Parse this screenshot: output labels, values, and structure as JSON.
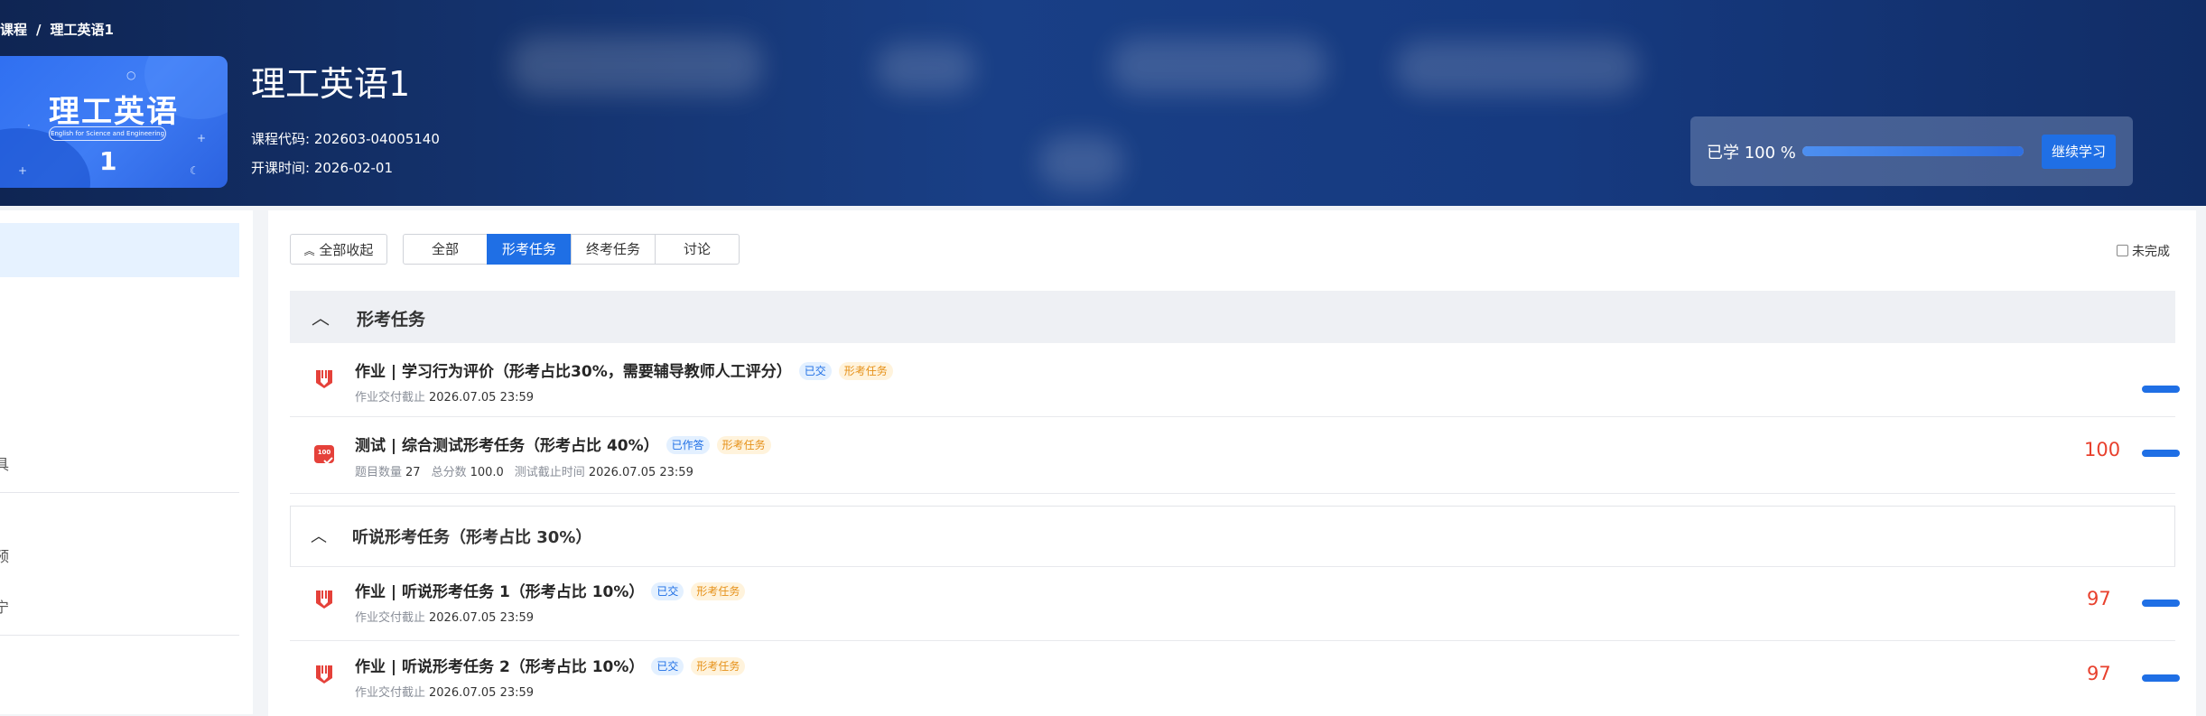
{
  "breadcrumb": {
    "parent": "我的课程",
    "separator": "/",
    "current": "理工英语1"
  },
  "course": {
    "cover_title": "理工英语",
    "cover_subtitle": "English for Science and Engineering",
    "cover_number": "1",
    "title": "理工英语1",
    "code_label": "课程代码:",
    "code_value": "202603-04005140",
    "start_label": "开课时间:",
    "start_value": "2026-02-01"
  },
  "progress": {
    "label": "已学 100 %",
    "percent": 100,
    "button": "继续学习"
  },
  "sidebar": {
    "items": [
      "具",
      "预",
      "宁"
    ]
  },
  "toolbar": {
    "collapse_all": "全部收起",
    "tabs": [
      "全部",
      "形考任务",
      "终考任务",
      "讨论"
    ],
    "active_tab": "形考任务",
    "filter_label": "未完成"
  },
  "group": {
    "title": "形考任务"
  },
  "rows": [
    {
      "title": "作业 | 学习行为评价（形考占比30%，需要辅导教师人工评分）",
      "status": "已交",
      "tag": "形考任务",
      "deadline_label": "作业交付截止",
      "deadline": "2026.07.05 23:59",
      "score": ""
    },
    {
      "title": "测试 | 综合测试形考任务（形考占比 40%）",
      "status": "已作答",
      "tag": "形考任务",
      "count_label": "题目数量",
      "count": "27",
      "total_label": "总分数",
      "total": "100.0",
      "deadline_label": "测试截止时间",
      "deadline": "2026.07.05 23:59",
      "score": "100"
    }
  ],
  "subgroup": {
    "title": "听说形考任务（形考占比 30%）",
    "rows": [
      {
        "title": "作业 | 听说形考任务 1（形考占比 10%）",
        "status": "已交",
        "tag": "形考任务",
        "deadline_label": "作业交付截止",
        "deadline": "2026.07.05 23:59",
        "score": "97"
      },
      {
        "title": "作业 | 听说形考任务 2（形考占比 10%）",
        "status": "已交",
        "tag": "形考任务",
        "deadline_label": "作业交付截止",
        "deadline": "2026.07.05 23:59",
        "score": "97"
      }
    ]
  },
  "colors": {
    "accent": "#1f6fe5",
    "score": "#e8402d",
    "tag_orange": "#e69119",
    "header_dark": "#0f2553"
  },
  "icons": {
    "homework": "homework-icon",
    "test": "test-100-icon",
    "chevron": "chevron-up-icon"
  }
}
